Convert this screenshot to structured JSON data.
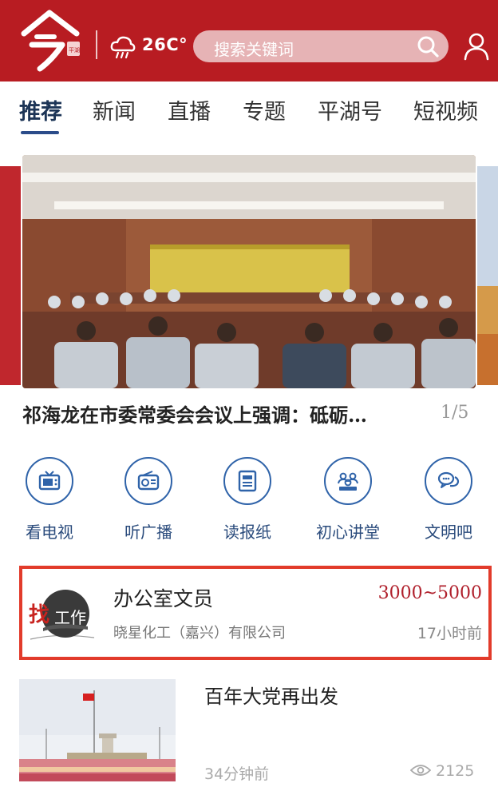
{
  "header": {
    "logo_text": "今",
    "logo_seal": "平湖",
    "temperature": "26C°",
    "search_placeholder": "搜索关键词",
    "icons": [
      "weather-cloud-icon",
      "search-icon",
      "user-icon"
    ]
  },
  "tabs": [
    {
      "label": "推荐",
      "active": true
    },
    {
      "label": "新闻"
    },
    {
      "label": "直播"
    },
    {
      "label": "专题"
    },
    {
      "label": "平湖号"
    },
    {
      "label": "短视频"
    }
  ],
  "carousel": {
    "headline": "祁海龙在市委常委会会议上强调：砥砺…",
    "pager": "1/5"
  },
  "quick_links": [
    {
      "label": "看电视",
      "icon": "tv-icon"
    },
    {
      "label": "听广播",
      "icon": "radio-icon"
    },
    {
      "label": "读报纸",
      "icon": "newspaper-icon"
    },
    {
      "label": "初心讲堂",
      "icon": "audience-icon"
    },
    {
      "label": "文明吧",
      "icon": "chat-bubbles-icon"
    }
  ],
  "job": {
    "logo_text_find": "找",
    "logo_text_work": "工作",
    "title": "办公室文员",
    "salary": "3000~5000",
    "company": "晓星化工（嘉兴）有限公司",
    "time": "17小时前"
  },
  "news": {
    "title": "百年大党再出发",
    "time": "34分钟前",
    "views": "2125"
  },
  "colors": {
    "header_red": "#b81c22",
    "tab_active": "#1d3557",
    "quick_icon_blue": "#2f63a9",
    "job_border": "#e23b2b",
    "salary": "#b0202c"
  }
}
